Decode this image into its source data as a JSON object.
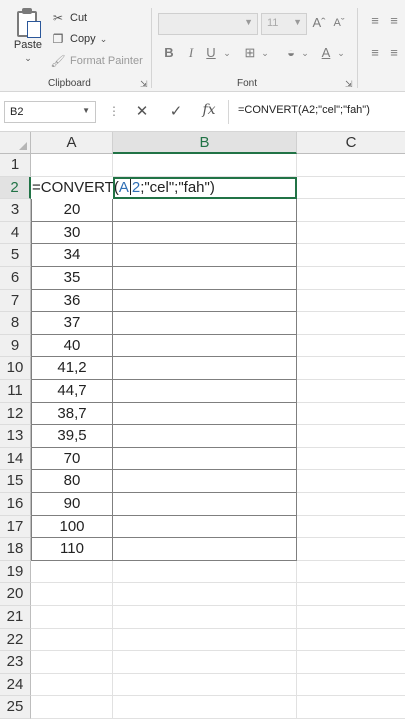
{
  "ribbon": {
    "clipboard": {
      "paste_label": "Paste",
      "cut_label": "Cut",
      "copy_label": "Copy",
      "format_painter_label": "Format Painter",
      "group_label": "Clipboard"
    },
    "font": {
      "font_name": "",
      "font_size": "11",
      "group_label": "Font",
      "bold": "B",
      "italic": "I",
      "underline": "U"
    }
  },
  "formula_bar": {
    "name_box": "B2",
    "formula": "=CONVERT(A2;\"cel\";\"fah\")"
  },
  "sheet": {
    "columns": [
      "A",
      "B",
      "C"
    ],
    "selected_column": "B",
    "selected_row": "2",
    "rows": [
      "1",
      "2",
      "3",
      "4",
      "5",
      "6",
      "7",
      "8",
      "9",
      "10",
      "11",
      "12",
      "13",
      "14",
      "15",
      "16",
      "17",
      "18",
      "19",
      "20",
      "21",
      "22",
      "23",
      "24",
      "25"
    ],
    "editing_cell": {
      "prefix": "=CONVERT(",
      "ref_a": "A",
      "ref_rest": "2",
      "suffix": ";\"cel\";\"fah\")"
    },
    "column_a_values": [
      "20",
      "30",
      "34",
      "35",
      "36",
      "37",
      "40",
      "41,2",
      "44,7",
      "38,7",
      "39,5",
      "70",
      "80",
      "90",
      "100",
      "110"
    ]
  },
  "colors": {
    "accent": "#217346",
    "reference": "#2f6fb5"
  }
}
